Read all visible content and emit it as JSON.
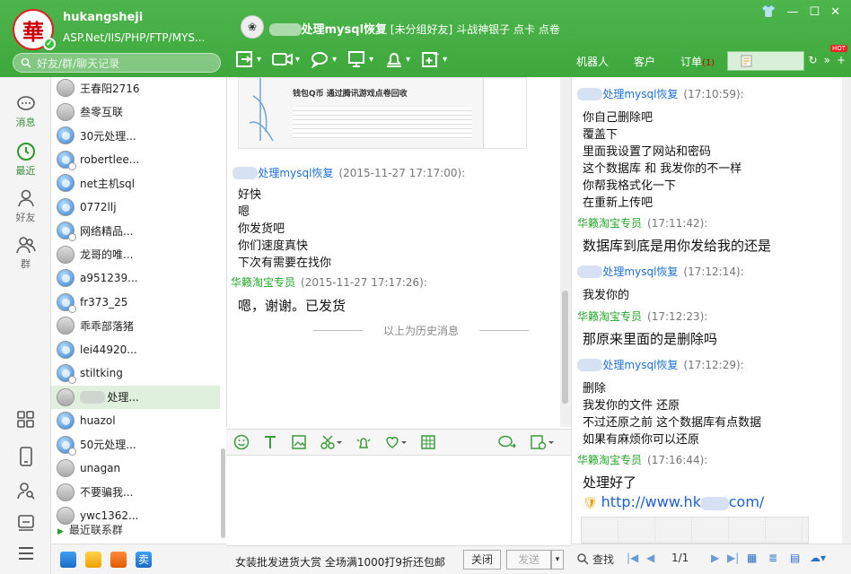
{
  "profile": {
    "logo_char": "華",
    "username": "hukangsheji",
    "signature": "ASP.Net/IIS/PHP/FTP/MYS...",
    "search_placeholder": "好友/群/聊天记录"
  },
  "chat_header": {
    "name_suffix": "处理mysql恢复",
    "group": "[未分组好友]",
    "status": "斗战神银子 点卡 点卷"
  },
  "tabs": [
    {
      "label": "机器人"
    },
    {
      "label": "客户"
    },
    {
      "label": "订单",
      "badge": "(1)"
    }
  ],
  "hot_badge": "HOT",
  "nav": [
    {
      "label": "消息"
    },
    {
      "label": "最近"
    },
    {
      "label": "好友"
    },
    {
      "label": "群"
    }
  ],
  "contacts": [
    {
      "name": "王春阳2716",
      "avatar": "grey"
    },
    {
      "name": "叁零互联",
      "avatar": "grey"
    },
    {
      "name": "30元处理...",
      "avatar": "blue"
    },
    {
      "name": "robertlee...",
      "avatar": "blue"
    },
    {
      "name": "net主机sql",
      "avatar": "blue"
    },
    {
      "name": "0772llj",
      "avatar": "blue"
    },
    {
      "name": "网络精品...",
      "avatar": "blue"
    },
    {
      "name": "龙哥的唯...",
      "avatar": "grey"
    },
    {
      "name": "a951239...",
      "avatar": "blue"
    },
    {
      "name": "fr373_25",
      "avatar": "blue"
    },
    {
      "name": "乖乖部落猪",
      "avatar": "grey"
    },
    {
      "name": "lei44920...",
      "avatar": "blue"
    },
    {
      "name": "stiltking",
      "avatar": "blue"
    },
    {
      "name": "处理...",
      "avatar": "grey",
      "selected": true
    },
    {
      "name": "huazol",
      "avatar": "blue"
    },
    {
      "name": "50元处理...",
      "avatar": "blue"
    },
    {
      "name": "unagan",
      "avatar": "grey"
    },
    {
      "name": "不要骗我...",
      "avatar": "grey"
    },
    {
      "name": "ywc1362...",
      "avatar": "grey"
    }
  ],
  "recent_group": "最近联系群",
  "chat": {
    "preview_title": "钱包Q币 通过腾讯游戏点卷回收",
    "messages": [
      {
        "from": "处理mysql恢复",
        "time": "(2015-11-27 17:17:00):",
        "lines": [
          "好快",
          "嗯",
          "你发货吧",
          "你们速度真快",
          "下次有需要在找你"
        ]
      },
      {
        "from": "华籁淘宝专员",
        "time": "(2015-11-27 17:17:26):",
        "lines": [
          "嗯，谢谢。已发货"
        ]
      }
    ],
    "history_divider": "以上为历史消息"
  },
  "sendbar": {
    "ad": "女装批发进货大赏  全场满1000打9折还包邮",
    "close": "关闭",
    "send": "发送"
  },
  "history": [
    {
      "from": "处理mysql恢复",
      "time": "(17:10:59):",
      "lines": [
        "你自己删除吧",
        "覆盖下",
        "里面我设置了网站和密码",
        "这个数据库 和 我发你的不一样",
        "你帮我格式化一下",
        "在重新上传吧"
      ]
    },
    {
      "from": "华籁淘宝专员",
      "time": "(17:11:42):",
      "lines": [
        "数据库到底是用你发给我的还是"
      ]
    },
    {
      "from": "处理mysql恢复",
      "time": "(17:12:14):",
      "lines": [
        "我发你的"
      ]
    },
    {
      "from": "华籁淘宝专员",
      "time": "(17:12:23):",
      "lines": [
        "那原来里面的是删除吗"
      ]
    },
    {
      "from": "处理mysql恢复",
      "time": "(17:12:29):",
      "lines": [
        "删除",
        "我发你的文件 还原",
        "不过还原之前 这个数据库有点数据",
        "如果有麻烦你可以还原"
      ]
    },
    {
      "from": "华籁淘宝专员",
      "time": "(17:16:44):",
      "lines": [
        "处理好了"
      ]
    }
  ],
  "history_link": "http://www.hk",
  "history_link_tail": "com/",
  "history_bottom": {
    "search": "查找",
    "page": "1/1"
  }
}
